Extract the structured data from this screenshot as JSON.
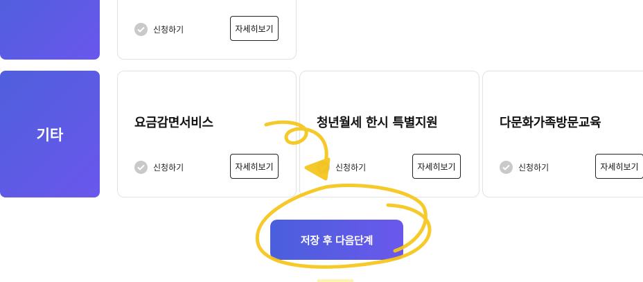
{
  "categories": {
    "top_label": "",
    "other_label": "기타"
  },
  "top_card": {
    "apply_label": "신청하기",
    "detail_label": "자세히보기"
  },
  "cards": [
    {
      "title": "요금감면서비스",
      "apply_label": "신청하기",
      "detail_label": "자세히보기"
    },
    {
      "title": "청년월세 한시 특별지원",
      "apply_label": "신청하기",
      "detail_label": "자세히보기"
    },
    {
      "title": "다문화가족방문교육",
      "apply_label": "신청하기",
      "detail_label": "자세히보기"
    }
  ],
  "footer": {
    "next_label": "저장 후 다음단계"
  },
  "colors": {
    "accent_start": "#4a5fdc",
    "accent_end": "#6a58ec",
    "annotation": "#f5c518",
    "check_gray": "#c9c9c9"
  },
  "icons": {
    "check": "check-circle-icon"
  }
}
